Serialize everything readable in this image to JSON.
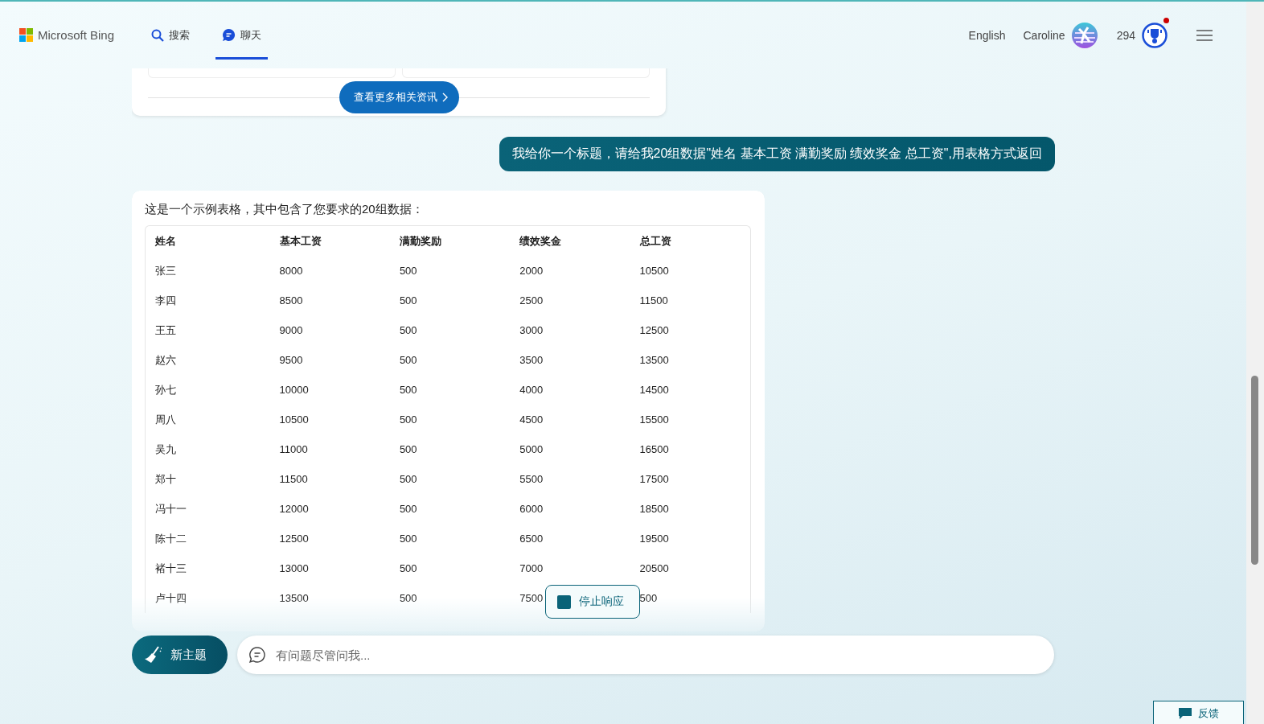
{
  "header": {
    "logo": "Microsoft Bing",
    "tabs": [
      {
        "label": "搜索",
        "kind": "search",
        "selected": false
      },
      {
        "label": "聊天",
        "kind": "chat",
        "selected": true
      }
    ],
    "language": "English",
    "user": "Caroline",
    "points": "294",
    "reward_notification": true
  },
  "news_card": {
    "more_button": "查看更多相关资讯"
  },
  "user_message": "我给你一个标题，请给我20组数据\"姓名 基本工资 满勤奖励 绩效奖金 总工资\",用表格方式返回",
  "bot_message": {
    "intro": "这是一个示例表格，其中包含了您要求的20组数据：",
    "table": {
      "columns": [
        "姓名",
        "基本工资",
        "满勤奖励",
        "绩效奖金",
        "总工资"
      ],
      "rows": [
        [
          "张三",
          "8000",
          "500",
          "2000",
          "10500"
        ],
        [
          "李四",
          "8500",
          "500",
          "2500",
          "11500"
        ],
        [
          "王五",
          "9000",
          "500",
          "3000",
          "12500"
        ],
        [
          "赵六",
          "9500",
          "500",
          "3500",
          "13500"
        ],
        [
          "孙七",
          "10000",
          "500",
          "4000",
          "14500"
        ],
        [
          "周八",
          "10500",
          "500",
          "4500",
          "15500"
        ],
        [
          "吴九",
          "11000",
          "500",
          "5000",
          "16500"
        ],
        [
          "郑十",
          "11500",
          "500",
          "5500",
          "17500"
        ],
        [
          "冯十一",
          "12000",
          "500",
          "6000",
          "18500"
        ],
        [
          "陈十二",
          "12500",
          "500",
          "6500",
          "19500"
        ],
        [
          "褚十三",
          "13000",
          "500",
          "7000",
          "20500"
        ],
        [
          "卢十四",
          "13500",
          "500",
          "7500",
          "500"
        ]
      ]
    }
  },
  "stop_button": "停止响应",
  "composer": {
    "new_topic": "新主题",
    "placeholder": "有问题尽管问我..."
  },
  "feedback": "反馈"
}
